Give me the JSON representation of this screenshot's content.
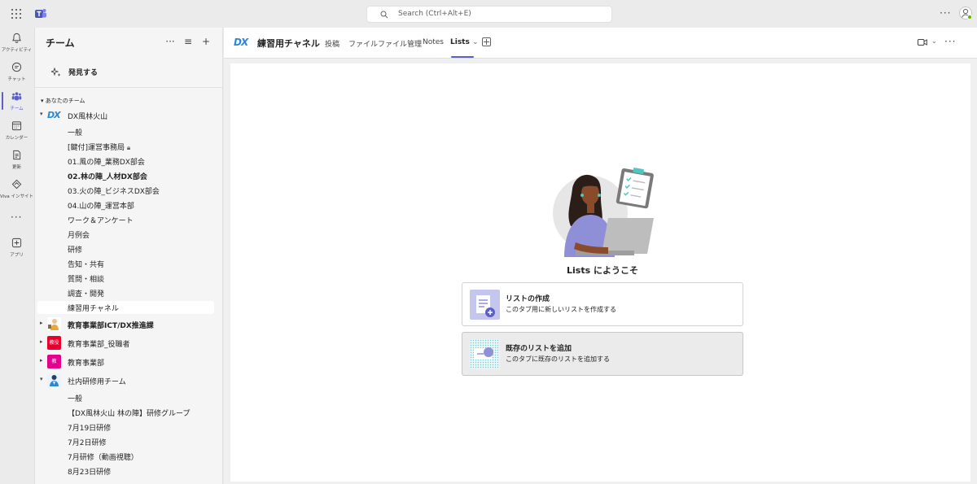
{
  "topbar": {
    "search_placeholder": "Search (Ctrl+Alt+E)",
    "more": "···"
  },
  "rail": {
    "items": [
      {
        "label": "アクティビティ",
        "icon": "bell-icon"
      },
      {
        "label": "チャット",
        "icon": "chat-icon"
      },
      {
        "label": "チーム",
        "icon": "teams-icon"
      },
      {
        "label": "カレンダー",
        "icon": "calendar-icon"
      },
      {
        "label": "更新",
        "icon": "updates-icon"
      },
      {
        "label": "Viva インサイト",
        "icon": "viva-insights-icon"
      },
      {
        "label": "アプリ",
        "icon": "apps-icon"
      }
    ],
    "more": "···"
  },
  "panel": {
    "title": "チーム",
    "more": "···",
    "filter": "≡",
    "add": "+",
    "discover": "発見する",
    "section": "あなたのチーム",
    "teams": [
      {
        "name": "DX風林火山",
        "channels": [
          "一般",
          "[鍵付]運営事務局",
          "01.風の陣_業務DX部会",
          "02.林の陣_人材DX部会",
          "03.火の陣_ビジネスDX部会",
          "04.山の陣_運営本部",
          "ワーク＆アンケート",
          "月例会",
          "研修",
          "告知・共有",
          "質問・相談",
          "調査・開発",
          "練習用チャネル"
        ]
      },
      {
        "name": "教育事業部ICT/DX推進課"
      },
      {
        "name": "教育事業部_役職者",
        "icon_text": "教役"
      },
      {
        "name": "教育事業部",
        "icon_text": "教"
      },
      {
        "name": "社内研修用チーム",
        "channels": [
          "一般",
          "【DX風林火山 林の陣】研修グループ",
          "7月19日研修",
          "7月2日研修",
          "7月研修（動画視聴）",
          "8月23日研修"
        ]
      }
    ],
    "dx_logo": "DX"
  },
  "header": {
    "logo": "DX",
    "channel_name": "練習用チャネル",
    "tabs": [
      "投稿",
      "ファイル",
      "ファイル管理",
      "Notes",
      "Lists"
    ],
    "active_tab": "Lists",
    "chevron": "⌄",
    "more": "···"
  },
  "main": {
    "welcome": "Lists にようこそ",
    "cards": [
      {
        "title": "リストの作成",
        "subtitle": "このタブ用に新しいリストを作成する"
      },
      {
        "title": "既存のリストを追加",
        "subtitle": "このタブに既存のリストを追加する"
      }
    ]
  },
  "colors": {
    "accent": "#5b5fc7",
    "dx_blue": "#2b88d8"
  }
}
